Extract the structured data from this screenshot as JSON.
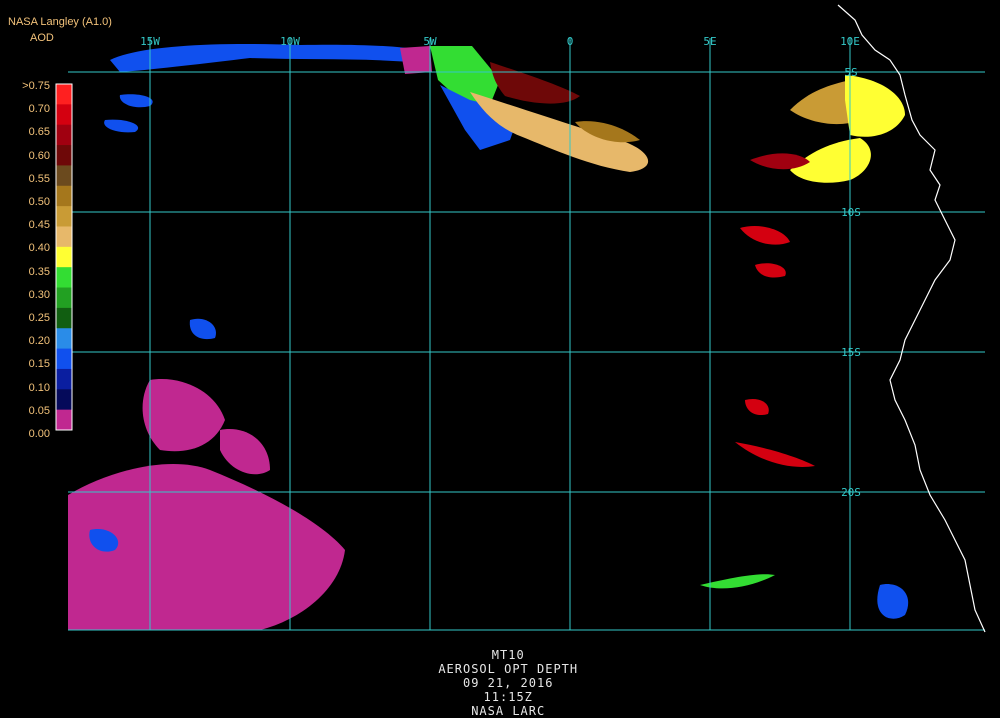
{
  "header": {
    "source": "NASA Langley (A1.0)",
    "product": "AOD"
  },
  "colorbar": {
    "labels": [
      ">0.75",
      "0.70",
      "0.65",
      "0.60",
      "0.55",
      "0.50",
      "0.45",
      "0.40",
      "0.35",
      "0.30",
      "0.25",
      "0.20",
      "0.15",
      "0.10",
      "0.05",
      "0.00"
    ],
    "colors": [
      "#ff2020",
      "#d40010",
      "#a00010",
      "#6e0808",
      "#6b4a1e",
      "#a5771c",
      "#c99b35",
      "#e7b86a",
      "#ffff33",
      "#33dd33",
      "#22a022",
      "#115e11",
      "#2a8ce8",
      "#1050ee",
      "#0a1ea0",
      "#050a5a",
      "#c02890"
    ]
  },
  "map": {
    "lon_labels": [
      "15W",
      "10W",
      "5W",
      "0",
      "5E",
      "10E"
    ],
    "lat_labels": [
      "5S",
      "10S",
      "15S",
      "20S"
    ],
    "grid_color": "#33c8c8",
    "coast_color": "#ffffff"
  },
  "footer": {
    "satellite": "MT10",
    "parameter": "AEROSOL OPT DEPTH",
    "date": "09 21, 2016",
    "time": "11:15Z",
    "agency": "NASA LARC"
  }
}
